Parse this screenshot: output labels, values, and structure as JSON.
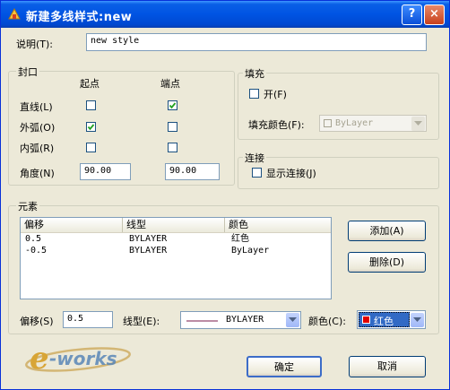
{
  "window": {
    "title": "新建多线样式:new",
    "help_symbol": "?",
    "close_symbol": "×"
  },
  "description": {
    "label": "说明(T):",
    "value": "new style"
  },
  "caps": {
    "group_label": "封口",
    "start_header": "起点",
    "end_header": "端点",
    "rows": [
      {
        "label": "直线(L)",
        "start_checked": false,
        "end_checked": true
      },
      {
        "label": "外弧(O)",
        "start_checked": true,
        "end_checked": false
      },
      {
        "label": "内弧(R)",
        "start_checked": false,
        "end_checked": false
      }
    ],
    "angle_label": "角度(N)",
    "angle_start": "90.00",
    "angle_end": "90.00"
  },
  "fill": {
    "group_label": "填充",
    "on_label": "开(F)",
    "on_checked": false,
    "color_label": "填充颜色(F):",
    "color_value": "ByLayer"
  },
  "joints": {
    "group_label": "连接",
    "show_label": "显示连接(J)",
    "show_checked": false
  },
  "elements": {
    "group_label": "元素",
    "columns": [
      "偏移",
      "线型",
      "颜色"
    ],
    "rows": [
      {
        "offset": "0.5",
        "linetype": "BYLAYER",
        "color": "红色"
      },
      {
        "offset": "-0.5",
        "linetype": "BYLAYER",
        "color": "ByLayer"
      }
    ],
    "add_button": "添加(A)",
    "delete_button": "删除(D)",
    "offset_label": "偏移(S)",
    "offset_value": "0.5",
    "linetype_label": "线型(E):",
    "linetype_value": "BYLAYER",
    "color_label": "颜色(C):",
    "color_value": "红色",
    "color_swatch": "#e00000"
  },
  "buttons": {
    "ok": "确定",
    "cancel": "取消"
  },
  "watermark": {
    "text": "e-works"
  },
  "colors": {
    "titlebar": "#0054e3",
    "dialog_bg": "#ece9d8",
    "selection": "#316ac5"
  }
}
